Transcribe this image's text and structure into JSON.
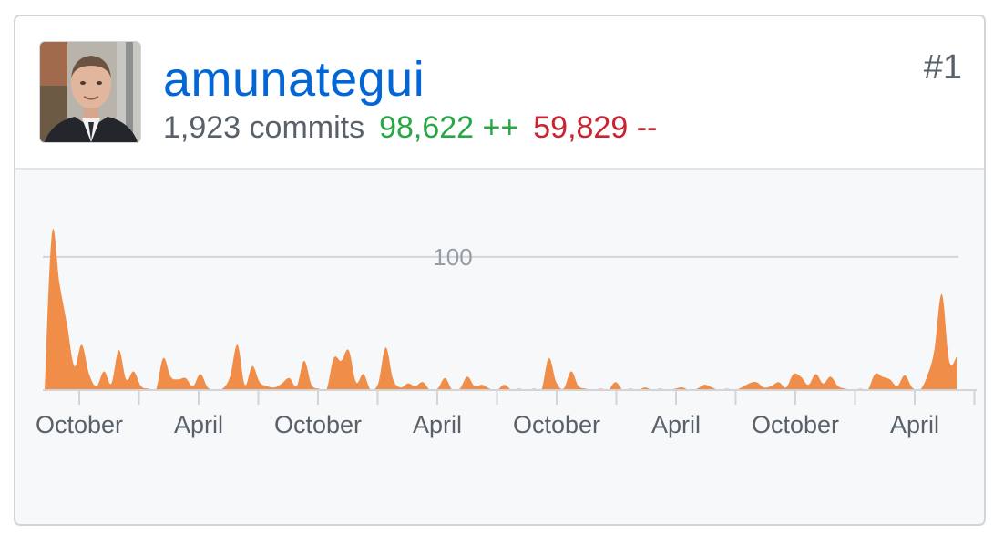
{
  "contributor": {
    "username": "amunategui",
    "rank": "#1",
    "commits": "1,923 commits",
    "additions": "98,622 ++",
    "deletions": "59,829 --"
  },
  "colors": {
    "area": "#f08d49",
    "username": "#0366d6",
    "additions": "#28a745",
    "deletions": "#cb2431"
  },
  "chart_data": {
    "type": "area",
    "title": "",
    "xlabel": "",
    "ylabel": "",
    "ylim": [
      0,
      130
    ],
    "yticks": [
      100
    ],
    "grid": true,
    "x_tick_labels": [
      "October",
      "April",
      "October",
      "April",
      "October",
      "April",
      "October",
      "April"
    ],
    "series": [
      {
        "values": [
          0,
          118,
          80,
          50,
          18,
          34,
          12,
          3,
          14,
          5,
          30,
          8,
          14,
          3,
          1,
          0,
          24,
          10,
          8,
          9,
          3,
          12,
          2,
          0,
          1,
          10,
          34,
          4,
          18,
          6,
          3,
          2,
          5,
          9,
          3,
          22,
          4,
          1,
          0,
          24,
          22,
          30,
          6,
          12,
          0,
          5,
          32,
          8,
          2,
          5,
          3,
          6,
          0,
          1,
          9,
          0,
          1,
          10,
          3,
          4,
          1,
          0,
          4,
          0,
          1,
          0,
          1,
          0,
          24,
          6,
          1,
          14,
          3,
          1,
          0,
          1,
          0,
          6,
          0,
          1,
          0,
          2,
          0,
          1,
          0,
          1,
          2,
          0,
          1,
          4,
          2,
          0,
          1,
          0,
          2,
          5,
          6,
          2,
          3,
          6,
          2,
          12,
          10,
          4,
          12,
          5,
          10,
          3,
          1,
          0,
          1,
          0,
          12,
          10,
          8,
          3,
          11,
          2,
          0,
          10,
          30,
          72,
          22,
          25
        ]
      }
    ]
  }
}
